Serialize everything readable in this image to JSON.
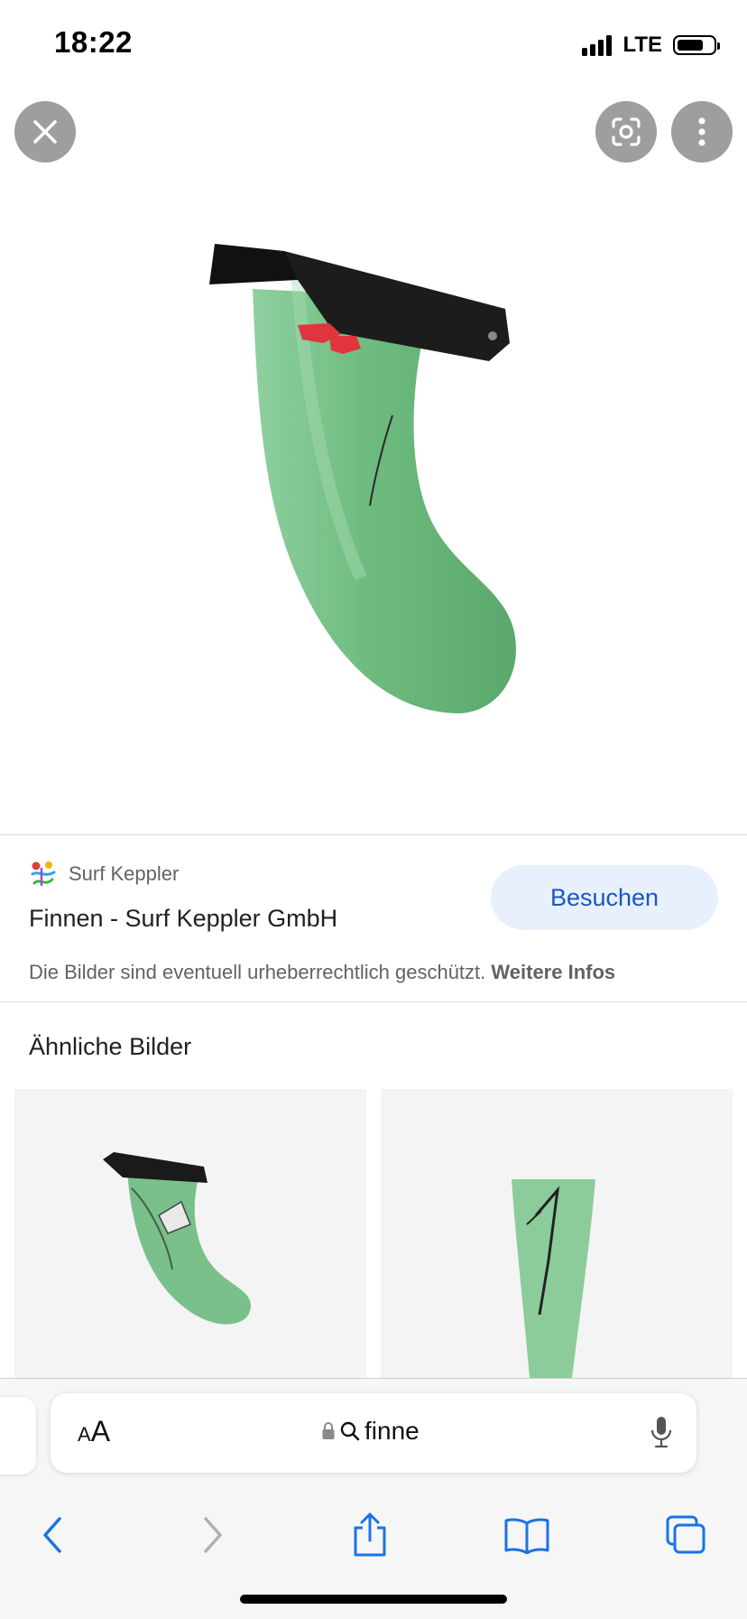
{
  "status_bar": {
    "time": "18:22",
    "network": "LTE"
  },
  "result": {
    "source_name": "Surf Keppler",
    "title": "Finnen - Surf Keppler GmbH",
    "visit_label": "Besuchen",
    "copyright_text": "Die Bilder sind eventuell urheberrechtlich geschützt.",
    "more_info_label": "Weitere Infos"
  },
  "similar": {
    "heading": "Ähnliche Bilder"
  },
  "browser": {
    "text_size_label_small": "A",
    "text_size_label_large": "A",
    "url": "finne"
  },
  "colors": {
    "accent": "#1a56c4",
    "visit_button_bg": "#e8f0fe",
    "fin_green": "#6dbb7e",
    "fin_base": "#1c1c1c"
  },
  "icons": {
    "close": "close-icon",
    "lens": "lens-icon",
    "more": "more-vert-icon",
    "lock": "lock-icon",
    "search": "search-icon",
    "mic": "mic-icon",
    "back": "back-icon",
    "forward": "forward-icon",
    "share": "share-icon",
    "bookmarks": "bookmarks-icon",
    "tabs": "tabs-icon"
  }
}
